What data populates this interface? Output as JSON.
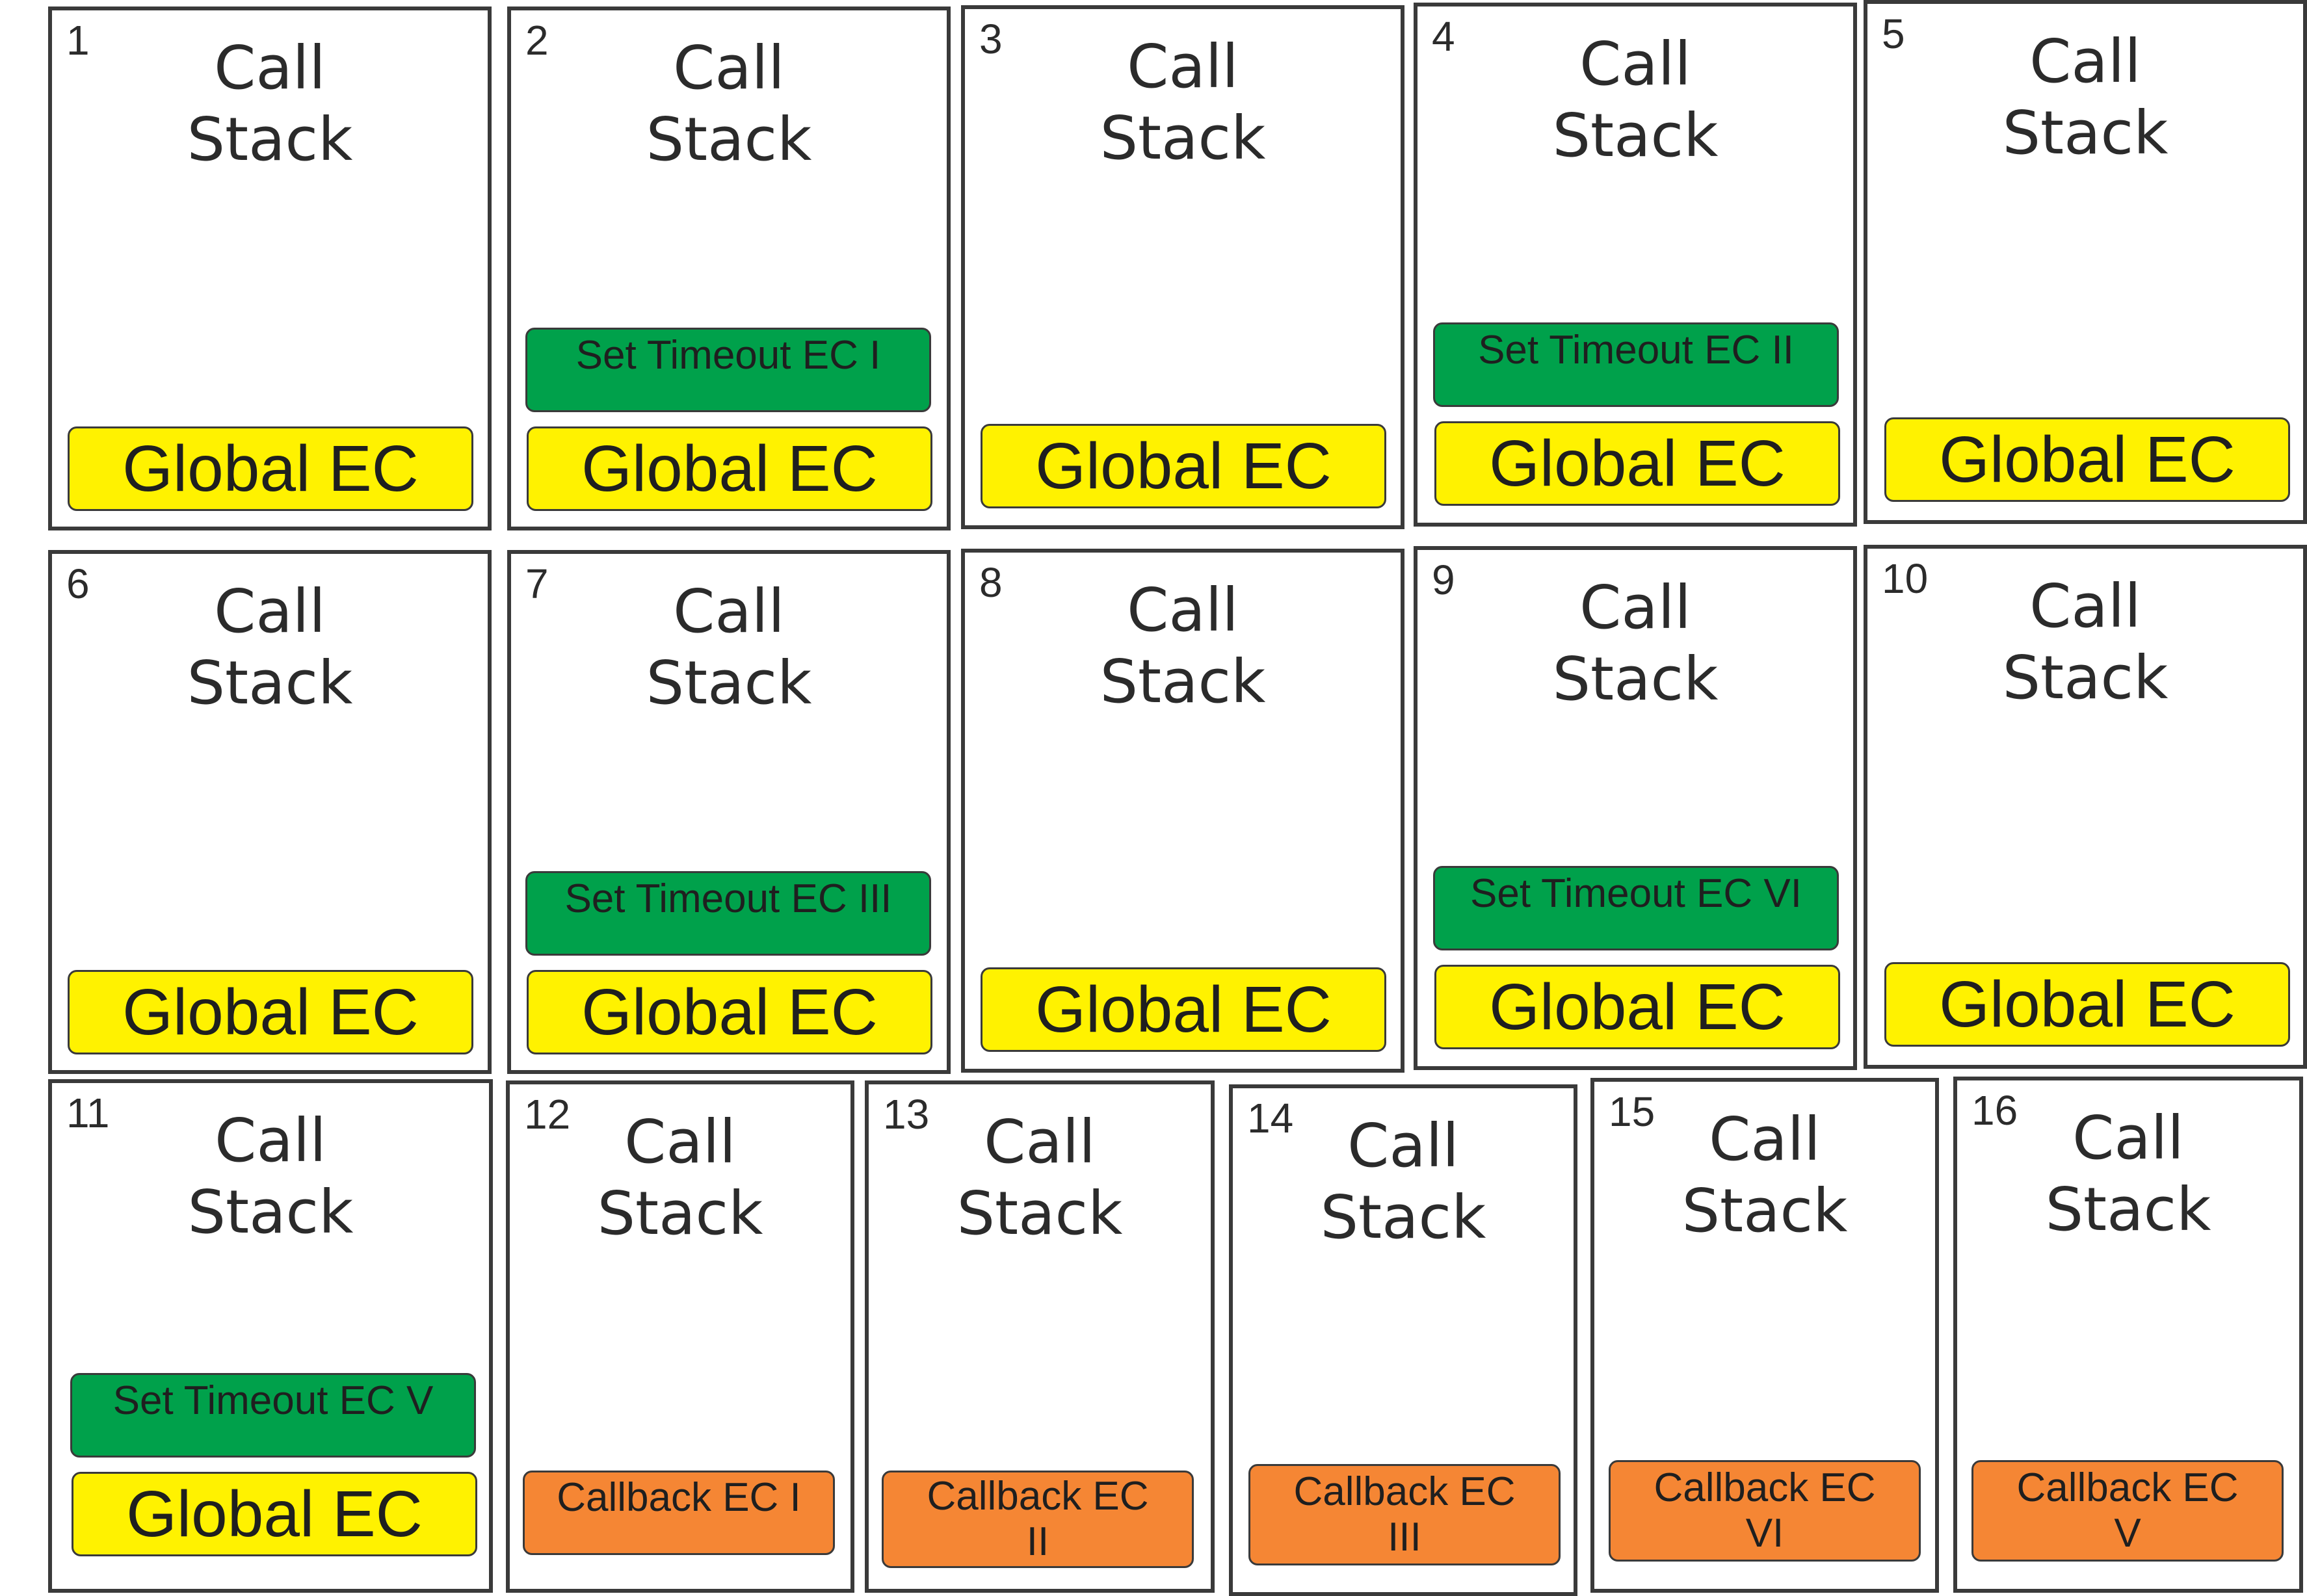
{
  "panels": [
    {
      "number": "1",
      "title_line1": "Call",
      "title_line2": "Stack",
      "global": "Global EC"
    },
    {
      "number": "2",
      "title_line1": "Call",
      "title_line2": "Stack",
      "timeout": "Set Timeout EC I",
      "global": "Global EC"
    },
    {
      "number": "3",
      "title_line1": "Call",
      "title_line2": "Stack",
      "global": "Global EC"
    },
    {
      "number": "4",
      "title_line1": "Call",
      "title_line2": "Stack",
      "timeout": "Set Timeout EC II",
      "global": "Global EC"
    },
    {
      "number": "5",
      "title_line1": "Call",
      "title_line2": "Stack",
      "global": "Global EC"
    },
    {
      "number": "6",
      "title_line1": "Call",
      "title_line2": "Stack",
      "global": "Global EC"
    },
    {
      "number": "7",
      "title_line1": "Call",
      "title_line2": "Stack",
      "timeout": "Set Timeout EC III",
      "global": "Global EC"
    },
    {
      "number": "8",
      "title_line1": "Call",
      "title_line2": "Stack",
      "global": "Global EC"
    },
    {
      "number": "9",
      "title_line1": "Call",
      "title_line2": "Stack",
      "timeout": "Set Timeout EC VI",
      "global": "Global EC"
    },
    {
      "number": "10",
      "title_line1": "Call",
      "title_line2": "Stack",
      "global": "Global EC"
    },
    {
      "number": "11",
      "title_line1": "Call",
      "title_line2": "Stack",
      "timeout": "Set Timeout EC V",
      "global": "Global EC"
    },
    {
      "number": "12",
      "title_line1": "Call",
      "title_line2": "Stack",
      "callback_line1": "Callback EC I"
    },
    {
      "number": "13",
      "title_line1": "Call",
      "title_line2": "Stack",
      "callback_line1": "Callback EC",
      "callback_line2": "II"
    },
    {
      "number": "14",
      "title_line1": "Call",
      "title_line2": "Stack",
      "callback_line1": "Callback EC",
      "callback_line2": "III"
    },
    {
      "number": "15",
      "title_line1": "Call",
      "title_line2": "Stack",
      "callback_line1": "Callback EC",
      "callback_line2": "VI"
    },
    {
      "number": "16",
      "title_line1": "Call",
      "title_line2": "Stack",
      "callback_line1": "Callback EC",
      "callback_line2": "V"
    }
  ],
  "colors": {
    "global_ec": "#fff200",
    "set_timeout_ec": "#00a14b",
    "callback_ec": "#f58634",
    "border": "#3a3a3a"
  }
}
